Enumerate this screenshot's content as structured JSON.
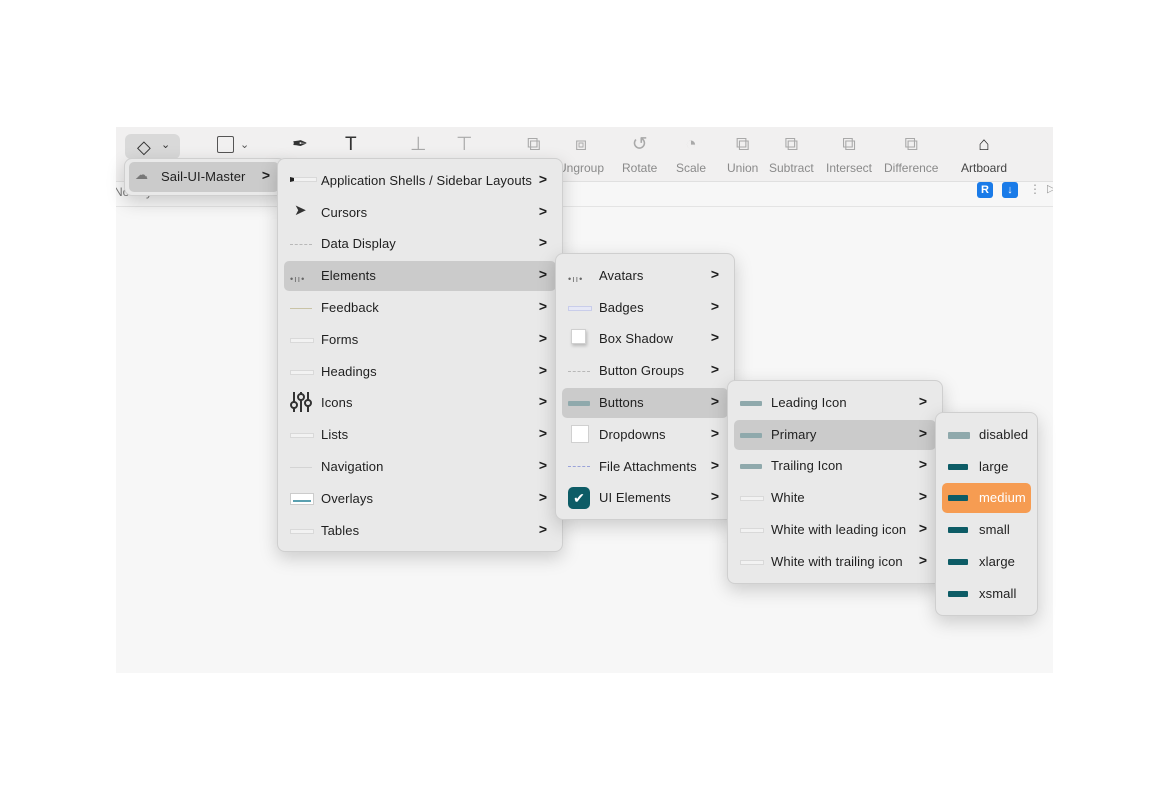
{
  "toolbar": {
    "insert_icon": "diamond-icon",
    "tools": [
      {
        "name": "pen-tool",
        "icon": "✒",
        "label": ""
      },
      {
        "name": "text-tool",
        "icon": "T",
        "label": ""
      },
      {
        "name": "align-tool",
        "icon": "⊥",
        "label": ""
      },
      {
        "name": "distribute-tool",
        "icon": "⊤",
        "label": ""
      },
      {
        "name": "group",
        "icon": "⧉",
        "label": ""
      },
      {
        "name": "ungroup",
        "icon": "⧈",
        "label": "Ungroup"
      },
      {
        "name": "rotate",
        "icon": "↺",
        "label": "Rotate"
      },
      {
        "name": "scale",
        "icon": "◔",
        "label": "Scale"
      },
      {
        "name": "union",
        "icon": "⧉",
        "label": "Union"
      },
      {
        "name": "subtract",
        "icon": "⧉",
        "label": "Subtract"
      },
      {
        "name": "intersect",
        "icon": "⧉",
        "label": "Intersect"
      },
      {
        "name": "difference",
        "icon": "⧉",
        "label": "Difference"
      },
      {
        "name": "artboard",
        "icon": "⌂",
        "label": "Artboard"
      }
    ]
  },
  "subbar": {
    "no_layers": "No Layers Selected",
    "mini_r": "R",
    "mini_down": "↓",
    "dots": "⋮",
    "play": "▷"
  },
  "menu0": {
    "items": [
      {
        "label": "Sail-UI-Master",
        "icon": "library-icon",
        "arrow": ">"
      }
    ]
  },
  "menu1": {
    "items": [
      {
        "label": "Application Shells / Sidebar Layouts",
        "thumb": "sidebar-layout",
        "arrow": ">"
      },
      {
        "label": "Cursors",
        "thumb": "cursor",
        "arrow": ">"
      },
      {
        "label": "Data Display",
        "thumb": "dash",
        "arrow": ">"
      },
      {
        "label": "Elements",
        "thumb": "dots",
        "arrow": ">"
      },
      {
        "label": "Feedback",
        "thumb": "line",
        "arrow": ">"
      },
      {
        "label": "Forms",
        "thumb": "thin",
        "arrow": ">"
      },
      {
        "label": "Headings",
        "thumb": "thin",
        "arrow": ">"
      },
      {
        "label": "Icons",
        "thumb": "sliders",
        "arrow": ">"
      },
      {
        "label": "Lists",
        "thumb": "thin",
        "arrow": ">"
      },
      {
        "label": "Navigation",
        "thumb": "line",
        "arrow": ">"
      },
      {
        "label": "Overlays",
        "thumb": "window",
        "arrow": ">"
      },
      {
        "label": "Tables",
        "thumb": "thin",
        "arrow": ">"
      }
    ]
  },
  "menu2": {
    "items": [
      {
        "label": "Avatars",
        "thumb": "dots",
        "arrow": ">"
      },
      {
        "label": "Badges",
        "thumb": "badge",
        "arrow": ">"
      },
      {
        "label": "Box Shadow",
        "thumb": "square",
        "arrow": ">"
      },
      {
        "label": "Button Groups",
        "thumb": "dash",
        "arrow": ">"
      },
      {
        "label": "Buttons",
        "thumb": "bar",
        "arrow": ">"
      },
      {
        "label": "Dropdowns",
        "thumb": "square",
        "arrow": ">"
      },
      {
        "label": "File Attachments",
        "thumb": "dotline",
        "arrow": ">"
      },
      {
        "label": "UI Elements",
        "thumb": "check",
        "check": "✔",
        "arrow": ">"
      }
    ]
  },
  "menu3": {
    "items": [
      {
        "label": "Leading Icon",
        "thumb": "bar",
        "arrow": ">"
      },
      {
        "label": "Primary",
        "thumb": "bar",
        "arrow": ">"
      },
      {
        "label": "Trailing Icon",
        "thumb": "bar",
        "arrow": ">"
      },
      {
        "label": "White",
        "thumb": "thin",
        "arrow": ">"
      },
      {
        "label": "White with leading icon",
        "thumb": "thin",
        "arrow": ">"
      },
      {
        "label": "White with trailing icon",
        "thumb": "thin",
        "arrow": ">"
      }
    ]
  },
  "menu4": {
    "items": [
      {
        "label": "disabled",
        "thumb": "bar"
      },
      {
        "label": "large",
        "thumb": "dark"
      },
      {
        "label": "medium",
        "thumb": "dark"
      },
      {
        "label": "small",
        "thumb": "dark"
      },
      {
        "label": "xlarge",
        "thumb": "dark"
      },
      {
        "label": "xsmall",
        "thumb": "dark"
      }
    ]
  },
  "colors": {
    "highlight": "#cbcbcb",
    "selected": "#f69c52",
    "brand_teal": "#0d5c66",
    "accent_blue": "#1a7be8"
  }
}
